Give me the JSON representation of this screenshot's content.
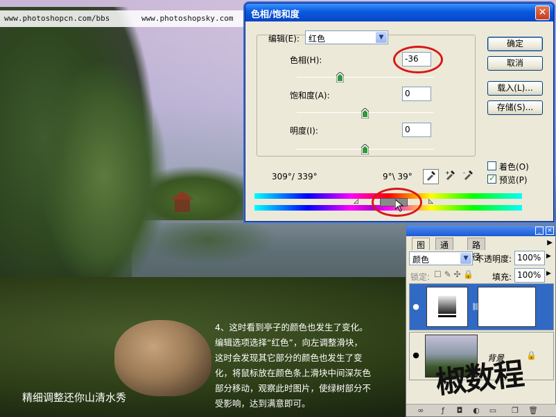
{
  "urls": {
    "left": "www.photoshopcn.com/bbs",
    "right": "www.photoshopsky.com"
  },
  "dialog": {
    "title": "色相/饱和度",
    "close": "✕",
    "edit_label": "编辑(E):",
    "edit_value": "红色",
    "hue_label": "色相(H):",
    "hue_value": "-36",
    "saturation_label": "饱和度(A):",
    "saturation_value": "0",
    "lightness_label": "明度(I):",
    "lightness_value": "0",
    "range_left": "309°/ 339°",
    "range_right": "9°\\ 39°",
    "buttons": {
      "ok": "确定",
      "cancel": "取消",
      "load": "载入(L)...",
      "save": "存储(S)..."
    },
    "colorize_label": "着色(O)",
    "colorize_checked": false,
    "preview_label": "预览(P)",
    "preview_checked": true,
    "slider_levels": {
      "hue": -36,
      "saturation": 0,
      "lightness": 0
    }
  },
  "layers_panel": {
    "tabs": [
      "图层",
      "通道",
      "路径"
    ],
    "blend_mode": "颜色",
    "opacity_label": "不透明度:",
    "opacity_value": "100%",
    "lock_label": "锁定:",
    "fill_label": "填充:",
    "fill_value": "100%",
    "background_layer_name": "背景"
  },
  "caption": "精细调整还你山清水秀",
  "note_lines": [
    "4、这时看到亭子的颜色也发生了变化。",
    "编辑选项选择“红色”，向左调整滑块，",
    "这时会发现其它部分的颜色也发生了变",
    "化，将鼠标放在颜色条上滑块中间深灰色",
    "部分移动，观察此时图片，使绿树部分不",
    "受影响，达到满意即可。"
  ],
  "signature": "椒数程",
  "colors": {
    "accent_red": "#d81818",
    "xp_title_blue": "#0a5ae0"
  }
}
